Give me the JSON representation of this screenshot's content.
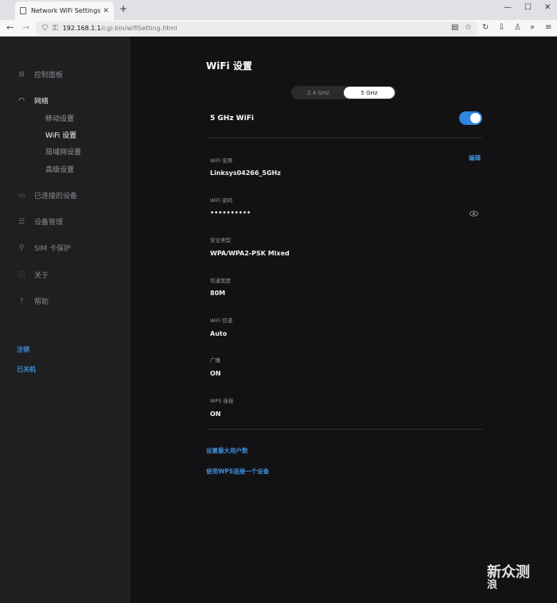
{
  "browser": {
    "tab_title": "Network WiFi Settings",
    "url_host": "192.168.1.1",
    "url_path": "/cgi-bin/wifiSetting.html"
  },
  "sidebar": {
    "items": [
      {
        "label": "控制面板",
        "icon": "dashboard-icon"
      },
      {
        "label": "网络",
        "icon": "wifi-icon"
      },
      {
        "label": "已连接的设备",
        "icon": "devices-icon"
      },
      {
        "label": "设备管理",
        "icon": "sliders-icon"
      },
      {
        "label": "SIM 卡保护",
        "icon": "lock-icon"
      },
      {
        "label": "关于",
        "icon": "info-icon"
      },
      {
        "label": "帮助",
        "icon": "help-icon"
      }
    ],
    "sub_items": [
      "移动设置",
      "WiFi 设置",
      "局域网设置",
      "高级设置"
    ],
    "logout": "注销",
    "shutdown": "已关机"
  },
  "main": {
    "title": "WiFi 设置",
    "band_options": [
      "2.4 GHz",
      "5 GHz"
    ],
    "selected_band": "5 GHz",
    "wifi_label": "5 GHz WiFi",
    "wifi_enabled": true,
    "edit_label": "编辑",
    "fields": [
      {
        "label": "WiFi 名称",
        "value": "Linksys04266_5GHz"
      },
      {
        "label": "WiFi 密码",
        "value": "••••••••••"
      },
      {
        "label": "安全类型",
        "value": "WPA/WPA2-PSK Mixed"
      },
      {
        "label": "信道宽度",
        "value": "80M"
      },
      {
        "label": "WiFi 信道",
        "value": "Auto"
      },
      {
        "label": "广播",
        "value": "ON"
      },
      {
        "label": "WPS 连接",
        "value": "ON"
      }
    ],
    "link_max_users": "设置最大用户数",
    "link_wps": "使用WPS连接一个设备"
  },
  "watermark": {
    "line1": "新",
    "line2": "浪",
    "line3": "众测"
  },
  "colors": {
    "accent": "#2e86de",
    "link": "#3e8ed8",
    "sidebar_bg": "#1f1f22",
    "main_bg": "#121215"
  }
}
